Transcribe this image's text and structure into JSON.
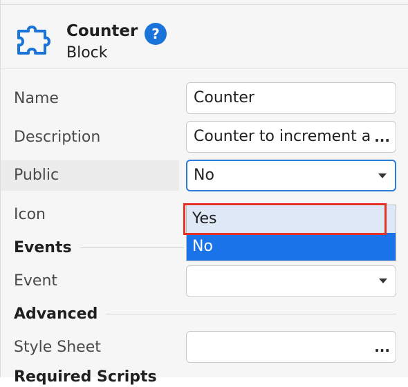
{
  "header": {
    "title": "Counter",
    "subtitle": "Block",
    "help_glyph": "?",
    "icon": "puzzle-icon",
    "accent": "#1a73d9"
  },
  "fields": {
    "name": {
      "label": "Name",
      "value": "Counter"
    },
    "description": {
      "label": "Description",
      "value": "Counter to increment a"
    },
    "public": {
      "label": "Public",
      "value": "No"
    },
    "icon": {
      "label": "Icon"
    },
    "event": {
      "label": "Event",
      "value": ""
    },
    "style_sheet": {
      "label": "Style Sheet",
      "value": ""
    }
  },
  "sections": {
    "events": "Events",
    "advanced": "Advanced",
    "required_scripts": "Required Scripts"
  },
  "dropdown": {
    "options": [
      {
        "label": "Yes",
        "state": "hovered"
      },
      {
        "label": "No",
        "state": "selected"
      }
    ],
    "highlight_color": "#e53225",
    "selected_color": "#1a73e8"
  },
  "ellipsis": "..."
}
